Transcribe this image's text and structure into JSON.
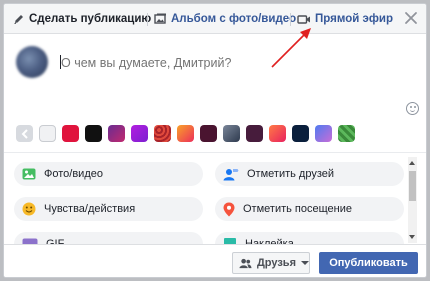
{
  "header": {
    "tabs": [
      {
        "label": "Сделать публикацию",
        "icon": "pencil-icon"
      },
      {
        "label": "Альбом с фото/видео",
        "icon": "album-icon"
      },
      {
        "label": "Прямой эфир",
        "icon": "video-camera-icon"
      }
    ],
    "close_icon": "close-icon"
  },
  "composer": {
    "placeholder": "О чем вы думаете, Дмитрий?"
  },
  "background_swatches": {
    "colors": [
      "#e4e6eb",
      "#e0143d",
      "#111111",
      "#6a2c91",
      "#b21fe0",
      "#b1322e",
      "#f05a2a",
      "#4a1430",
      "#3c4a5e",
      "#471c3c",
      "#f0405a",
      "#0a1f3c",
      "#4f7bf0",
      "#3a8a3a"
    ]
  },
  "options": [
    {
      "label": "Фото/видео",
      "icon": "photo-icon",
      "color": "#45bd62"
    },
    {
      "label": "Отметить друзей",
      "icon": "tag-friends-icon",
      "color": "#1877f2"
    },
    {
      "label": "Чувства/действия",
      "icon": "feeling-icon",
      "color": "#f7b928"
    },
    {
      "label": "Отметить посещение",
      "icon": "location-pin-icon",
      "color": "#f5533d"
    },
    {
      "label": "GIF",
      "icon": "gif-icon",
      "color": "#8c72cb"
    },
    {
      "label": "Наклейка",
      "icon": "sticker-icon",
      "color": "#2abba7"
    }
  ],
  "footer": {
    "audience_label": "Друзья",
    "publish_label": "Опубликовать"
  },
  "colors": {
    "brand": "#4267b2",
    "link": "#365899",
    "annotation_arrow": "#e02020"
  }
}
